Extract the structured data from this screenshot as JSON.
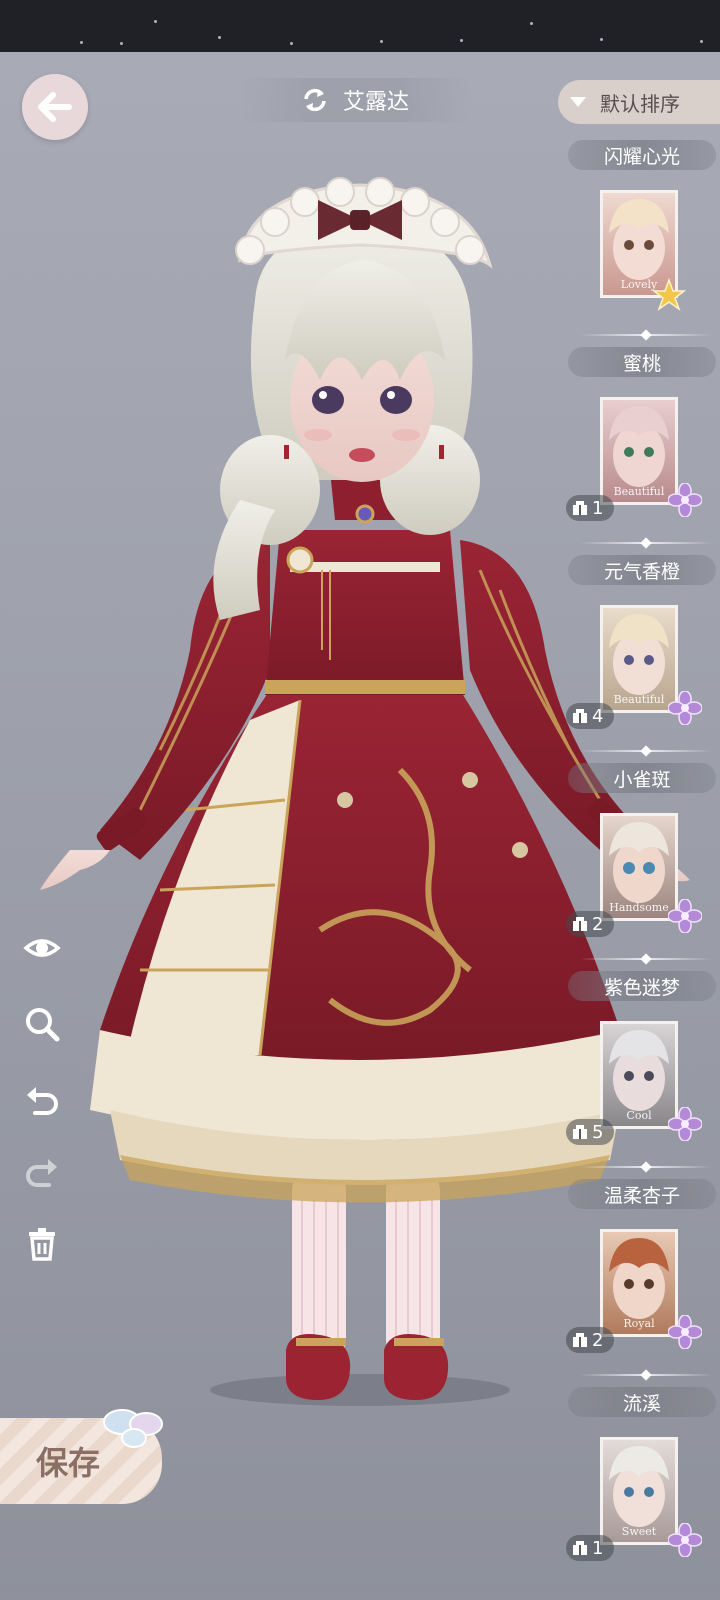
{
  "header": {
    "character_name": "艾露达",
    "sort_label": "默认排序"
  },
  "save_label": "保存",
  "makeup_list": [
    {
      "name": "闪耀心光",
      "tag": "Lovely",
      "count": "",
      "rarity": "gold"
    },
    {
      "name": "蜜桃",
      "tag": "Beautiful",
      "count": "1",
      "rarity": "purple"
    },
    {
      "name": "元气香橙",
      "tag": "Beautiful",
      "count": "4",
      "rarity": "purple"
    },
    {
      "name": "小雀斑",
      "tag": "Handsome",
      "count": "2",
      "rarity": "purple"
    },
    {
      "name": "紫色迷梦",
      "tag": "Cool",
      "count": "5",
      "rarity": "purple"
    },
    {
      "name": "温柔杏子",
      "tag": "Royal",
      "count": "2",
      "rarity": "purple"
    },
    {
      "name": "流溪",
      "tag": "Sweet",
      "count": "1",
      "rarity": "purple"
    }
  ],
  "colors": {
    "dress": "#8e1f2e",
    "apron": "#efe6d4",
    "gold_trim": "#c9a45a",
    "hair": "#e4e2d8",
    "rarity_gold": "#f2c64a",
    "rarity_purple": "#b48ad8"
  },
  "icons": {
    "back": "arrow-left-icon",
    "switch": "refresh-icon",
    "tools": [
      "eye-icon",
      "zoom-icon",
      "undo-icon",
      "redo-icon",
      "trash-icon"
    ]
  }
}
